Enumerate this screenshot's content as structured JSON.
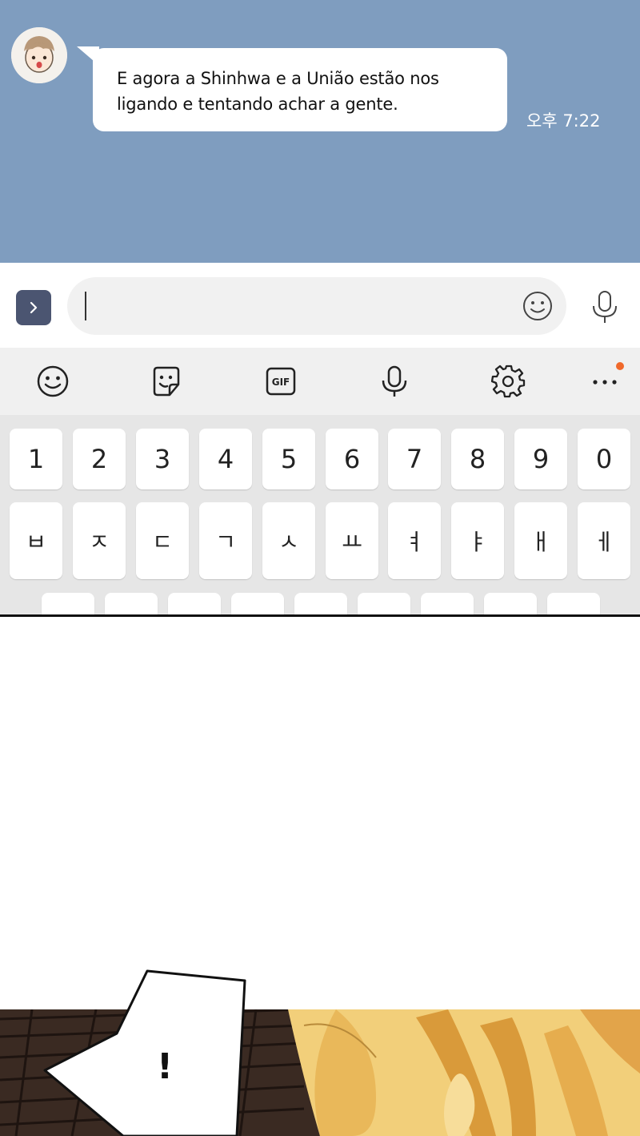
{
  "chat": {
    "message_line1": "E agora a Shinhwa e a União estão nos",
    "message_line2": "ligando e tentando achar a gente.",
    "timestamp": "오후 7:22"
  },
  "input_bar": {
    "expand_icon": "chevron-right-icon",
    "emoji_icon": "smiley-icon",
    "mic_icon": "microphone-icon"
  },
  "toolbar": {
    "items": [
      "emoji-icon",
      "sticker-icon",
      "gif-icon",
      "voice-input-icon",
      "settings-icon",
      "more-icon"
    ],
    "gif_label": "GIF"
  },
  "keyboard": {
    "number_row": [
      "1",
      "2",
      "3",
      "4",
      "5",
      "6",
      "7",
      "8",
      "9",
      "0"
    ],
    "hangul_row": [
      "ㅂ",
      "ㅈ",
      "ㄷ",
      "ㄱ",
      "ㅅ",
      "ㅛ",
      "ㅕ",
      "ㅑ",
      "ㅐ",
      "ㅔ"
    ]
  },
  "comic": {
    "exclamation": "!"
  },
  "colors": {
    "chat_background": "#7f9dbf",
    "expand_button": "#4b5571",
    "notification_dot": "#f0692b"
  }
}
